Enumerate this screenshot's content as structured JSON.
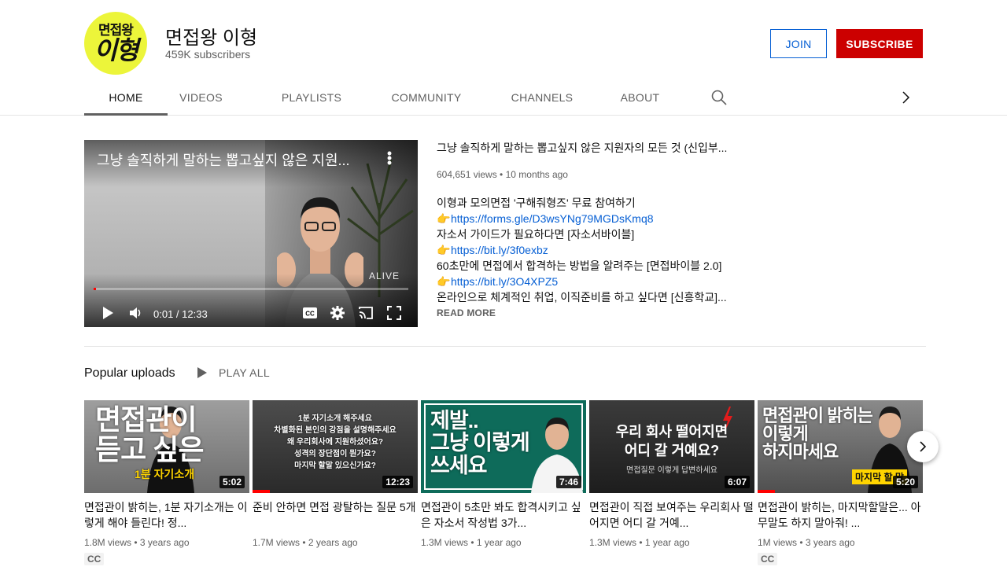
{
  "channel": {
    "avatar_line1": "면접왕",
    "avatar_line2": "이형",
    "name": "면접왕 이형",
    "subscribers": "459K subscribers",
    "join_label": "JOIN",
    "subscribe_label": "SUBSCRIBE"
  },
  "tabs": [
    {
      "label": "HOME"
    },
    {
      "label": "VIDEOS"
    },
    {
      "label": "PLAYLISTS"
    },
    {
      "label": "COMMUNITY"
    },
    {
      "label": "CHANNELS"
    },
    {
      "label": "ABOUT"
    }
  ],
  "featured": {
    "player_title": "그냥 솔직하게 말하는 뽑고싶지 않은 지원...",
    "time": "0:01 / 12:33",
    "brand": "ALIVE",
    "progress": 0.0013,
    "title": "그냥 솔직하게 말하는 뽑고싶지 않은 지원자의 모든 것 (신입부...",
    "meta": "604,651 views • 10 months ago",
    "desc": [
      {
        "text": "이형과 모의면접 '구해줘형즈' 무료 참여하기",
        "link": false
      },
      {
        "text": "https://forms.gle/D3wsYNg79MGDsKmq8",
        "link": true
      },
      {
        "text": "자소서 가이드가 필요하다면 [자소서바이블]",
        "link": false
      },
      {
        "text": "https://bit.ly/3f0exbz",
        "link": true
      },
      {
        "text": "60초만에 면접에서 합격하는 방법을 알려주는 [면접바이블 2.0]",
        "link": false
      },
      {
        "text": "https://bit.ly/3O4XPZ5",
        "link": true
      },
      {
        "text": "온라인으로 체계적인 취업, 이직준비를 하고 싶다면 [신흥학교]...",
        "link": false
      }
    ],
    "read_more": "READ MORE"
  },
  "popular": {
    "title": "Popular uploads",
    "play_all": "PLAY ALL",
    "videos": [
      {
        "thumb_text": "면접관이\n듣고 싶은",
        "thumb_sub": "1분 자기소개",
        "duration": "5:02",
        "title": "면접관이 밝히는, 1분 자기소개는 이렇게 해야 들린다! 정...",
        "meta": "1.8M views • 3 years ago",
        "cc": "CC"
      },
      {
        "thumb_text": "1분 자기소개 해주세요\n차별화된 본인의 강점을 설명해주세요\n왜 우리회사에 지원하셨어요?\n성격의 장단점이 뭔가요?\n마지막 할말 있으신가요?",
        "thumb_sub": "",
        "duration": "12:23",
        "title": "준비 안하면 면접 광탈하는 질문 5개",
        "meta": "1.7M views • 2 years ago",
        "cc": ""
      },
      {
        "thumb_text": "제발..\n그냥 이렇게\n쓰세요",
        "thumb_sub": "",
        "duration": "7:46",
        "title": "면접관이 5초만 봐도 합격시키고 싶은 자소서 작성법 3가...",
        "meta": "1.3M views • 1 year ago",
        "cc": ""
      },
      {
        "thumb_text": "우리 회사 떨어지면\n어디 갈 거예요?",
        "thumb_sub": "면접질문 이렇게 답변하세요",
        "duration": "6:07",
        "title": "면접관이 직접 보여주는 우리회사 떨어지면 어디 갈 거예...",
        "meta": "1.3M views • 1 year ago",
        "cc": ""
      },
      {
        "thumb_text": "면접관이 밝히는\n이렇게\n하지마세요",
        "thumb_sub": "마지막 할 말",
        "duration": "5:20",
        "title": "면접관이 밝히는, 마지막할말은... 아무말도 하지 말아줘! ...",
        "meta": "1M views • 3 years ago",
        "cc": "CC"
      }
    ]
  },
  "colors": {
    "subscribe": "#cc0000",
    "join": "#065fd4",
    "link": "#065fd4",
    "avatar_bg": "#ecf53a",
    "progress": "#ff0000"
  }
}
